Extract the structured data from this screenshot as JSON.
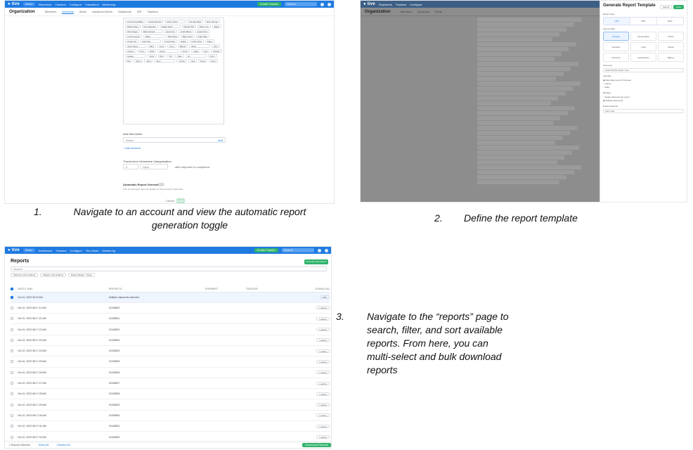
{
  "steps": [
    {
      "number": "1.",
      "text": "Navigate to an account and view the automatic report generation toggle"
    },
    {
      "number": "2.",
      "text": "Define the report template"
    },
    {
      "number": "3.",
      "text": "Navigate to the “reports” page to search, filter, and sort available reports. From here, you can multi-select and bulk download reports"
    }
  ],
  "app": {
    "brand": "tive",
    "accent": "#1f7ae0",
    "green": "#2fb36b",
    "env_pill": "Demo",
    "nav": [
      "Shipments",
      "Trackers",
      "Configure",
      "Transitions",
      "Monitoring"
    ],
    "create_button": "Create Tracker",
    "search_placeholder": "Search"
  },
  "panel1": {
    "page_title": "Organization",
    "tabs": [
      "Members",
      "Accounts",
      "Alerts",
      "Advanced Alerts",
      "Shipments",
      "API",
      "Trackers"
    ],
    "tags": [
      "Ammerica Alfalfa",
      "Vancis Brand",
      "Oliver Norm",
      "Timothy Ellis",
      "Rick Cluster",
      "Michel Haw",
      "Dos Reptiles",
      "Jackie Ness",
      "Marsh Phil",
      "Danny Fa",
      "Elgar",
      "Rich Roger",
      "Beth Howell",
      "Jean Kerr",
      "Keith Bains",
      "Josef Chen",
      "Crane House",
      "Mako",
      "Red Wing",
      "Blue Point",
      "Lake Side",
      "Ocean Air",
      "Hub One",
      "Cold Chain",
      "Stella",
      "North Post",
      "Peter",
      "Jules Fares",
      "Mira",
      "Luxe",
      "Kaur",
      "Baxter",
      "Silva",
      "Rue",
      "Anders",
      "Ford",
      "Vidal",
      "Mona",
      "Cresc",
      "Vega",
      "Lyle",
      "Rowan",
      "Quade",
      "Noor",
      "Ibis",
      "Tor",
      "Gale",
      "Lin",
      "Ozzy",
      "Pia",
      "Wren",
      "Abel",
      "Sten",
      "Corbin",
      "Yael",
      "Drew",
      "Fenn"
    ],
    "new_alerts_label": "Add New Alerts",
    "select_placeholder": "Select",
    "add_button": "Add",
    "add_more_link": "+ Add Another",
    "threshold_label": "Threshold to Determine Categorization",
    "threshold_value": "3",
    "threshold_unit": "Days",
    "threshold_note": "after shipment is completed",
    "auto_report_label": "Automatic Report Generation",
    "auto_report_desc": "Turn on automatic report generation for this account's shipments",
    "cancel": "Cancel",
    "save": "Save"
  },
  "panel2": {
    "page_title": "Organization",
    "drawer_title": "Generate Report Template",
    "drawer_cancel": "Cancel",
    "drawer_save": "Save",
    "report_type_label": "Report Type",
    "report_types": [
      "CSV",
      "PDF",
      "Both"
    ],
    "sensor_data_label": "Sensor Data",
    "sensors": [
      "Location",
      "Temperature",
      "Probe",
      "Humidity",
      "Light",
      "Shock",
      "Pressure",
      "Acceleration",
      "Battery"
    ],
    "timezone_label": "Timezone",
    "timezone_value": "(GMT-08:00) Pacific Time",
    "interval_label": "Intervals",
    "interval_options": [
      "Raw data every 15 minutes",
      "Hourly",
      "Daily"
    ],
    "bundle_label": "Bundles",
    "bundle_options": [
      "Single shipment per report",
      "Multiple shipments"
    ],
    "email_label": "Email recipients",
    "email_placeholder": "Add email"
  },
  "panel3": {
    "page_title": "Reports",
    "tabs": [
      "Dashboard",
      "Trackers",
      "Configure",
      "Tive Alerts",
      "Monitoring"
    ],
    "search_placeholder": "Search",
    "top_button": "Generate New Report",
    "filters": [
      "Shipment: All Locations",
      "Shipper: All Locations",
      "Report Range: 7 Days"
    ],
    "columns": [
      "DATE & TIME",
      "REPORT ID",
      "SHIPMENT",
      "TRACKER",
      "DOWNLOAD"
    ],
    "rows": [
      {
        "date": "Oct 10, 2023 08:29 AM",
        "id": "Multiple shipments selected",
        "status": "PDF"
      },
      {
        "date": "Oct 10, 2023 08:17:10 AM",
        "id": "02425820",
        "status": "Loading"
      },
      {
        "date": "Oct 10, 2023 08:17:21 AM",
        "id": "02425821",
        "status": "Loading"
      },
      {
        "date": "Oct 10, 2023 08:17:22 AM",
        "id": "02425822",
        "status": "Loading"
      },
      {
        "date": "Oct 10, 2023 08:17:23 AM",
        "id": "02425823",
        "status": "Loading"
      },
      {
        "date": "Oct 10, 2023 08:17:24 AM",
        "id": "02425824",
        "status": "Loading"
      },
      {
        "date": "Oct 10, 2023 08:17:25 AM",
        "id": "02425825",
        "status": "Loading"
      },
      {
        "date": "Oct 10, 2023 08:17:26 AM",
        "id": "02425826",
        "status": "Loading"
      },
      {
        "date": "Oct 10, 2023 08:17:27 AM",
        "id": "02425827",
        "status": "Loading"
      },
      {
        "date": "Oct 10, 2023 08:17:28 AM",
        "id": "02425828",
        "status": "Loading"
      },
      {
        "date": "Oct 10, 2023 08:17:29 AM",
        "id": "02425829",
        "status": "Loading"
      },
      {
        "date": "Oct 10, 2023 08:17:30 AM",
        "id": "02425830",
        "status": "Loading"
      },
      {
        "date": "Oct 10, 2023 08:17:31 AM",
        "id": "02425831",
        "status": "Loading"
      },
      {
        "date": "Oct 10, 2023 08:17:32 AM",
        "id": "02425832",
        "status": "Loading"
      }
    ],
    "footer_selected": "1 Reports Selected",
    "footer_select_all": "Select All",
    "footer_deselect": "Deselect All",
    "footer_download": "Download Reports"
  }
}
